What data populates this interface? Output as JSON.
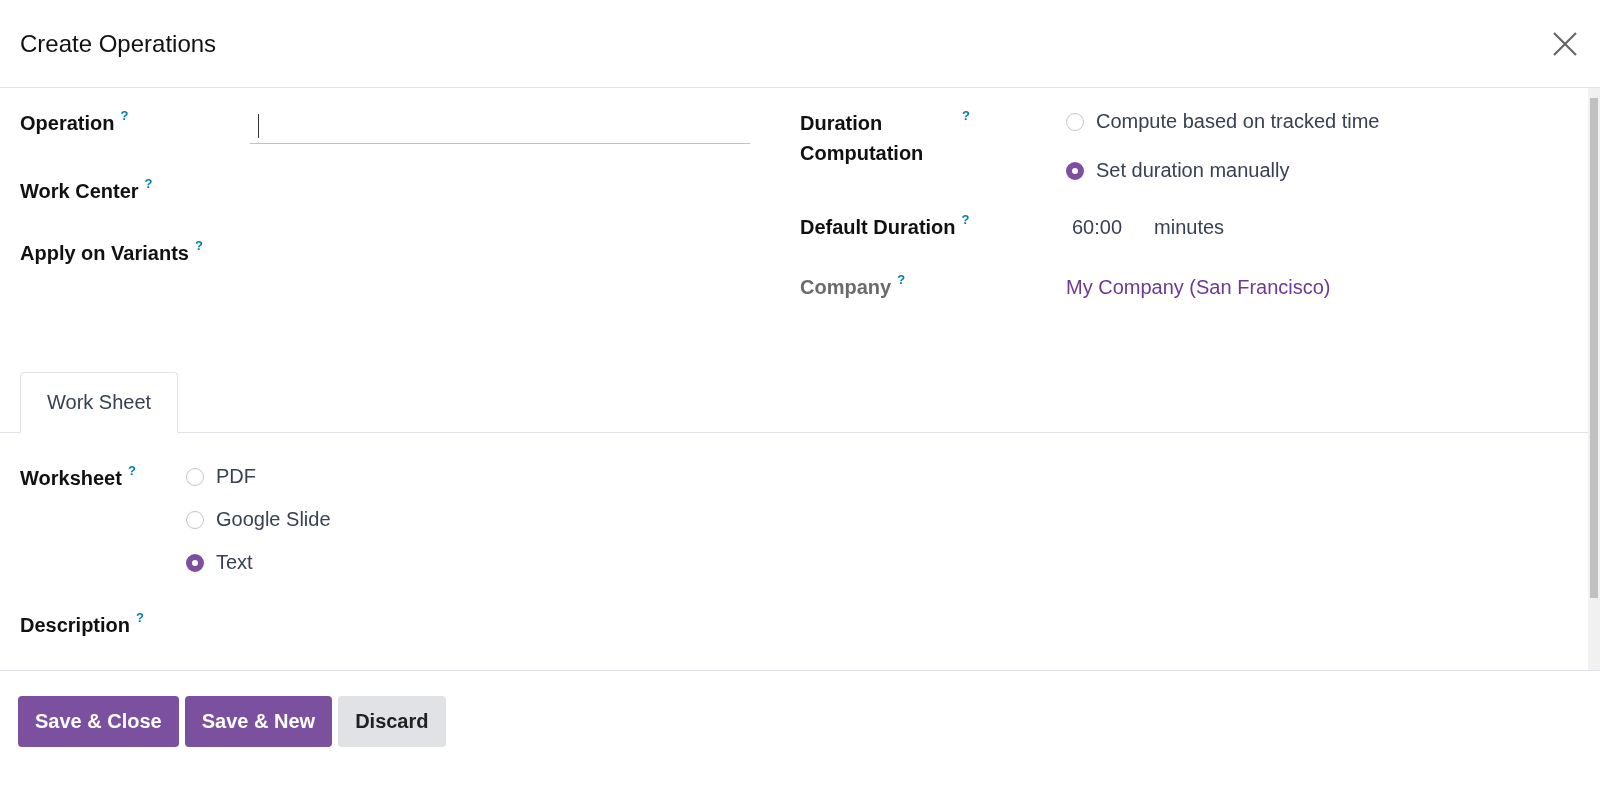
{
  "dialog": {
    "title": "Create Operations"
  },
  "left_fields": [
    {
      "label": "Operation",
      "help": "?",
      "kind": "input"
    },
    {
      "label": "Work Center",
      "help": "?",
      "kind": "empty"
    },
    {
      "label": "Apply on Variants",
      "help": "?",
      "kind": "empty"
    }
  ],
  "right_fields": [
    {
      "label": "Duration Computation",
      "help": "?",
      "kind": "radio",
      "options": [
        {
          "label": "Compute based on tracked time",
          "selected": false
        },
        {
          "label": "Set duration manually",
          "selected": true
        }
      ]
    },
    {
      "label": "Default Duration",
      "help": "?",
      "kind": "duration",
      "value": "60:00",
      "unit": "minutes"
    },
    {
      "label": "Company",
      "help": "?",
      "kind": "link",
      "muted": true,
      "value": "My Company (San Francisco)"
    }
  ],
  "tabs": [
    {
      "label": "Work Sheet",
      "selected": true
    }
  ],
  "sheet_fields": [
    {
      "label": "Worksheet",
      "help": "?",
      "kind": "radio",
      "options": [
        {
          "label": "PDF",
          "selected": false
        },
        {
          "label": "Google Slide",
          "selected": false
        },
        {
          "label": "Text",
          "selected": true
        }
      ]
    },
    {
      "label": "Description",
      "help": "?",
      "kind": "empty"
    }
  ],
  "buttons": [
    {
      "label": "Save & Close",
      "kind": "primary"
    },
    {
      "label": "Save & New",
      "kind": "primary"
    },
    {
      "label": "Discard",
      "kind": "secondary"
    }
  ]
}
